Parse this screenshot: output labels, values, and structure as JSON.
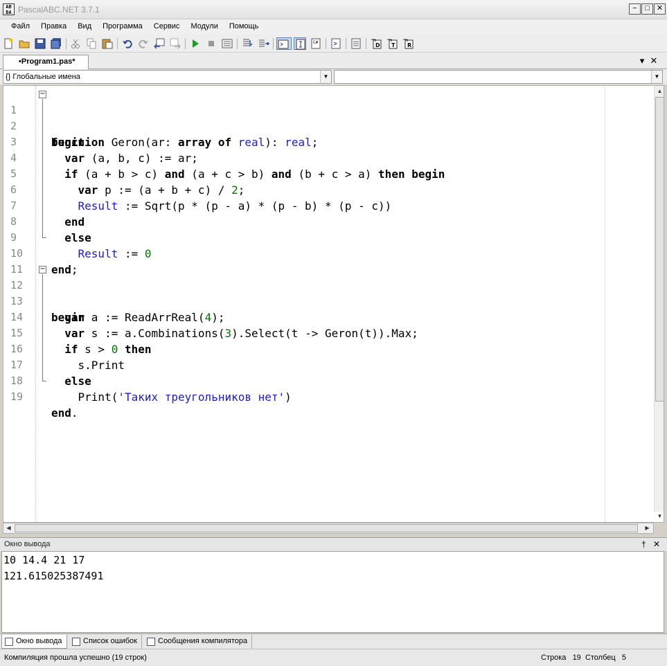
{
  "window": {
    "title": "PascalABC.NET 3.7.1",
    "icon_text": "AB BA",
    "minimize": "−",
    "maximize": "□",
    "close": "✕"
  },
  "menu": [
    "Файл",
    "Правка",
    "Вид",
    "Программа",
    "Сервис",
    "Модули",
    "Помощь"
  ],
  "toolbar_icons": [
    "new-file-icon",
    "open-icon",
    "save-icon",
    "save-all-icon",
    "cut-icon",
    "copy-icon",
    "paste-icon",
    "undo-icon",
    "redo-icon",
    "navigate-back-icon",
    "navigate-forward-icon",
    "run-icon",
    "stop-icon",
    "compile-icon",
    "step-into-icon",
    "step-over-icon",
    "output-panel-icon",
    "intellisense-icon",
    "form-designer-icon",
    "comment-icon",
    "format-icon",
    "debug-d-icon",
    "debug-t-icon",
    "debug-r-icon"
  ],
  "tab": {
    "label": "•Program1.pas*"
  },
  "scope_combo": {
    "text": "{} Глобальные имена"
  },
  "code_lines": [
    {
      "n": "1"
    },
    {
      "n": "2"
    },
    {
      "n": "3"
    },
    {
      "n": "4"
    },
    {
      "n": "5"
    },
    {
      "n": "6"
    },
    {
      "n": "7"
    },
    {
      "n": "8"
    },
    {
      "n": "9"
    },
    {
      "n": "10"
    },
    {
      "n": "11"
    },
    {
      "n": "12"
    },
    {
      "n": "13"
    },
    {
      "n": "14"
    },
    {
      "n": "15"
    },
    {
      "n": "16"
    },
    {
      "n": "17"
    },
    {
      "n": "18"
    },
    {
      "n": "19"
    }
  ],
  "code": {
    "l1": {
      "a": "function",
      "b": " Geron(ar: ",
      "c": "array",
      "d": " ",
      "e": "of",
      "f": " ",
      "g": "real",
      "h": "): ",
      "i": "real",
      "j": ";"
    },
    "l2": {
      "a": "begin"
    },
    "l3": {
      "a": "  ",
      "b": "var",
      "c": " (a, b, c) := ar;"
    },
    "l4": {
      "a": "  ",
      "b": "if",
      "c": " (a + b > c) ",
      "d": "and",
      "e": " (a + c > b) ",
      "f": "and",
      "g": " (b + c > a) ",
      "h": "then",
      "i": " ",
      "j": "begin"
    },
    "l5": {
      "a": "    ",
      "b": "var",
      "c": " p := (a + b + c) / ",
      "d": "2",
      "e": ";"
    },
    "l6": {
      "a": "    ",
      "b": "Result",
      "c": " := Sqrt(p * (p - a) * (p - b) * (p - c))"
    },
    "l7": {
      "a": "  ",
      "b": "end"
    },
    "l8": {
      "a": "  ",
      "b": "else"
    },
    "l9": {
      "a": "    ",
      "b": "Result",
      "c": " := ",
      "d": "0"
    },
    "l10": {
      "a": "end",
      "b": ";"
    },
    "l12": {
      "a": "begin"
    },
    "l13": {
      "a": "  ",
      "b": "var",
      "c": " a := ReadArrReal(",
      "d": "4",
      "e": ");"
    },
    "l14": {
      "a": "  ",
      "b": "var",
      "c": " s := a.Combinations(",
      "d": "3",
      "e": ").Select(t -> Geron(t)).Max;"
    },
    "l15": {
      "a": "  ",
      "b": "if",
      "c": " s > ",
      "d": "0",
      "e": " ",
      "f": "then"
    },
    "l16": {
      "a": "    s.Print"
    },
    "l17": {
      "a": "  ",
      "b": "else"
    },
    "l18": {
      "a": "    Print(",
      "b": "'Таких треугольников нет'",
      "c": ")"
    },
    "l19": {
      "a": "end",
      "b": "."
    }
  },
  "output_panel": {
    "title": "Окно вывода",
    "pin": "†",
    "close": "✕",
    "lines": [
      "10 14.4 21 17",
      "121.615025387491"
    ]
  },
  "bottom_tabs": [
    "Окно вывода",
    "Список ошибок",
    "Сообщения компилятора"
  ],
  "status": {
    "message": "Компиляция прошла успешно (19 строк)",
    "row_label": "Строка",
    "row_value": "19",
    "col_label": "Столбец",
    "col_value": "5"
  },
  "colors": {
    "keyword_blue": "#1b1bd1",
    "number_green": "#007300"
  }
}
